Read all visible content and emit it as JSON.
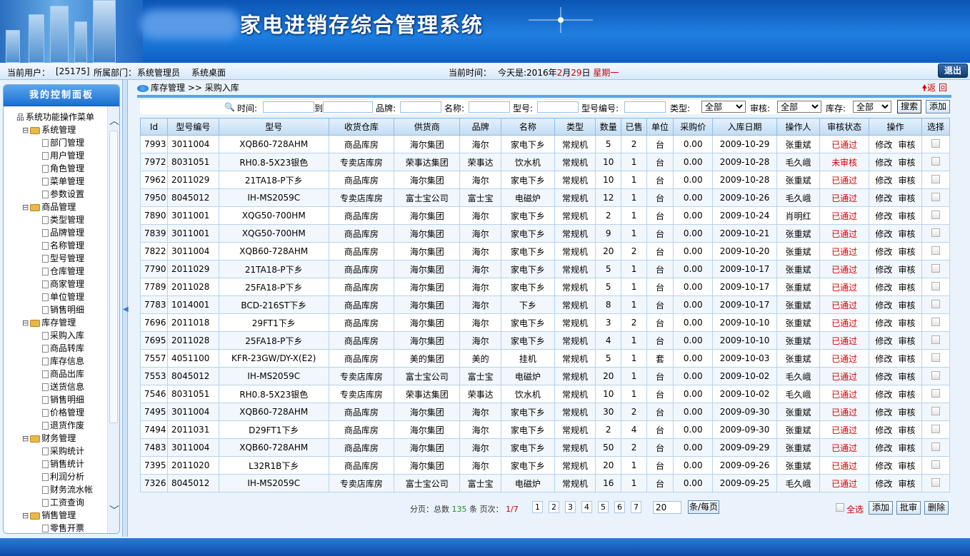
{
  "banner": {
    "title": "家电进销存综合管理系统"
  },
  "infobar": {
    "user_label": "当前用户：",
    "user_value": "[25175]",
    "dept_label": "所属部门：",
    "dept_value": "系统管理员",
    "desktop": "系统桌面",
    "time_label": "当前时间：",
    "today_prefix": "今天是:2016年",
    "month": "2",
    "month_suffix": "月",
    "day": "29",
    "day_suffix": "日",
    "weekday": "星期一",
    "logout": "退出"
  },
  "sidebar": {
    "title": "我的控制面板",
    "root": "系统功能操作菜单",
    "groups": [
      {
        "label": "系统管理",
        "items": [
          "部门管理",
          "用户管理",
          "角色管理",
          "菜单管理",
          "参数设置"
        ]
      },
      {
        "label": "商品管理",
        "items": [
          "类型管理",
          "品牌管理",
          "名称管理",
          "型号管理",
          "仓库管理",
          "商家管理",
          "单位管理",
          "销售明细"
        ]
      },
      {
        "label": "库存管理",
        "items": [
          "采购入库",
          "商品转库",
          "库存信息",
          "商品出库",
          "送货信息",
          "销售明细",
          "价格管理",
          "退货作废"
        ]
      },
      {
        "label": "财务管理",
        "items": [
          "采购统计",
          "销售统计",
          "利润分析",
          "财务流水帐",
          "工资查询"
        ]
      },
      {
        "label": "销售管理",
        "items": [
          "零售开票"
        ]
      }
    ]
  },
  "crumb": {
    "section": "库存管理",
    "sep": ">>",
    "page": "采购入库",
    "back": "返 回"
  },
  "search": {
    "time": "时间:",
    "to": "到",
    "brand": "品牌:",
    "name": "名称:",
    "model": "型号:",
    "model_no": "型号编号:",
    "type": "类型:",
    "type_value": "全部",
    "audit": "审核:",
    "audit_value": "全部",
    "stock": "库存:",
    "stock_value": "全部",
    "search_btn": "搜索",
    "add_btn": "添加"
  },
  "table": {
    "headers": [
      "Id",
      "型号编号",
      "型号",
      "收货仓库",
      "供货商",
      "品牌",
      "名称",
      "类型",
      "数量",
      "已售",
      "单位",
      "采购价",
      "入库日期",
      "操作人",
      "审核状态",
      "操作",
      "选择"
    ],
    "edit": "修改",
    "audit": "审核",
    "rows": [
      [
        "7993",
        "3011004",
        "XQB60-728AHM",
        "商品库房",
        "海尔集团",
        "海尔",
        "家电下乡",
        "常规机",
        "5",
        "2",
        "台",
        "0.00",
        "2009-10-29",
        "张重斌",
        "已通过"
      ],
      [
        "7972",
        "8031051",
        "RH0.8-5X23银色",
        "专卖店库房",
        "荣事达集团",
        "荣事达",
        "饮水机",
        "常规机",
        "10",
        "1",
        "台",
        "0.00",
        "2009-10-28",
        "毛久峨",
        "未审核"
      ],
      [
        "7962",
        "2011029",
        "21TA18-P下乡",
        "商品库房",
        "海尔集团",
        "海尔",
        "家电下乡",
        "常规机",
        "10",
        "1",
        "台",
        "0.00",
        "2009-10-28",
        "张重斌",
        "已通过"
      ],
      [
        "7950",
        "8045012",
        "IH-MS2059C",
        "专卖店库房",
        "富士宝公司",
        "富士宝",
        "电磁炉",
        "常规机",
        "12",
        "1",
        "台",
        "0.00",
        "2009-10-26",
        "毛久峨",
        "已通过"
      ],
      [
        "7890",
        "3011001",
        "XQG50-700HM",
        "商品库房",
        "海尔集团",
        "海尔",
        "家电下乡",
        "常规机",
        "2",
        "1",
        "台",
        "0.00",
        "2009-10-24",
        "肖明红",
        "已通过"
      ],
      [
        "7839",
        "3011001",
        "XQG50-700HM",
        "商品库房",
        "海尔集团",
        "海尔",
        "家电下乡",
        "常规机",
        "9",
        "1",
        "台",
        "0.00",
        "2009-10-21",
        "张重斌",
        "已通过"
      ],
      [
        "7822",
        "3011004",
        "XQB60-728AHM",
        "商品库房",
        "海尔集团",
        "海尔",
        "家电下乡",
        "常规机",
        "20",
        "2",
        "台",
        "0.00",
        "2009-10-20",
        "张重斌",
        "已通过"
      ],
      [
        "7790",
        "2011029",
        "21TA18-P下乡",
        "商品库房",
        "海尔集团",
        "海尔",
        "家电下乡",
        "常规机",
        "5",
        "1",
        "台",
        "0.00",
        "2009-10-17",
        "张重斌",
        "已通过"
      ],
      [
        "7789",
        "2011028",
        "25FA18-P下乡",
        "商品库房",
        "海尔集团",
        "海尔",
        "家电下乡",
        "常规机",
        "5",
        "1",
        "台",
        "0.00",
        "2009-10-17",
        "张重斌",
        "已通过"
      ],
      [
        "7783",
        "1014001",
        "BCD-216ST下乡",
        "商品库房",
        "海尔集团",
        "海尔",
        "下乡",
        "常规机",
        "8",
        "1",
        "台",
        "0.00",
        "2009-10-17",
        "张重斌",
        "已通过"
      ],
      [
        "7696",
        "2011018",
        "29FT1下乡",
        "商品库房",
        "海尔集团",
        "海尔",
        "家电下乡",
        "常规机",
        "3",
        "2",
        "台",
        "0.00",
        "2009-10-10",
        "张重斌",
        "已通过"
      ],
      [
        "7695",
        "2011028",
        "25FA18-P下乡",
        "商品库房",
        "海尔集团",
        "海尔",
        "家电下乡",
        "常规机",
        "4",
        "1",
        "台",
        "0.00",
        "2009-10-10",
        "张重斌",
        "已通过"
      ],
      [
        "7557",
        "4051100",
        "KFR-23GW/DY-X(E2)",
        "商品库房",
        "美的集团",
        "美的",
        "挂机",
        "常规机",
        "5",
        "1",
        "套",
        "0.00",
        "2009-10-03",
        "张重斌",
        "已通过"
      ],
      [
        "7553",
        "8045012",
        "IH-MS2059C",
        "专卖店库房",
        "富士宝公司",
        "富士宝",
        "电磁炉",
        "常规机",
        "20",
        "1",
        "台",
        "0.00",
        "2009-10-02",
        "毛久峨",
        "已通过"
      ],
      [
        "7546",
        "8031051",
        "RH0.8-5X23银色",
        "专卖店库房",
        "荣事达集团",
        "荣事达",
        "饮水机",
        "常规机",
        "10",
        "1",
        "台",
        "0.00",
        "2009-10-02",
        "毛久峨",
        "已通过"
      ],
      [
        "7495",
        "3011004",
        "XQB60-728AHM",
        "商品库房",
        "海尔集团",
        "海尔",
        "家电下乡",
        "常规机",
        "30",
        "2",
        "台",
        "0.00",
        "2009-09-30",
        "张重斌",
        "已通过"
      ],
      [
        "7494",
        "2011031",
        "D29FT1下乡",
        "商品库房",
        "海尔集团",
        "海尔",
        "家电下乡",
        "常规机",
        "2",
        "4",
        "台",
        "0.00",
        "2009-09-30",
        "张重斌",
        "已通过"
      ],
      [
        "7483",
        "3011004",
        "XQB60-728AHM",
        "商品库房",
        "海尔集团",
        "海尔",
        "家电下乡",
        "常规机",
        "50",
        "2",
        "台",
        "0.00",
        "2009-09-29",
        "张重斌",
        "已通过"
      ],
      [
        "7395",
        "2011020",
        "L32R1B下乡",
        "商品库房",
        "海尔集团",
        "海尔",
        "家电下乡",
        "常规机",
        "20",
        "1",
        "台",
        "0.00",
        "2009-09-26",
        "张重斌",
        "已通过"
      ],
      [
        "7326",
        "8045012",
        "IH-MS2059C",
        "专卖店库房",
        "富士宝公司",
        "富士宝",
        "电磁炉",
        "常规机",
        "16",
        "1",
        "台",
        "0.00",
        "2009-09-25",
        "毛久峨",
        "已通过"
      ]
    ]
  },
  "pager": {
    "prefix": "分页：总数",
    "total": "135",
    "mid": "条 页次：",
    "current": "1",
    "slash": "/",
    "pages_total": "7",
    "pages": [
      "1",
      "2",
      "3",
      "4",
      "5",
      "6",
      "7"
    ],
    "size": "20",
    "per": "条/每页",
    "select_all": "全选",
    "add": "添加",
    "batch_audit": "批审",
    "delete": "删除"
  }
}
